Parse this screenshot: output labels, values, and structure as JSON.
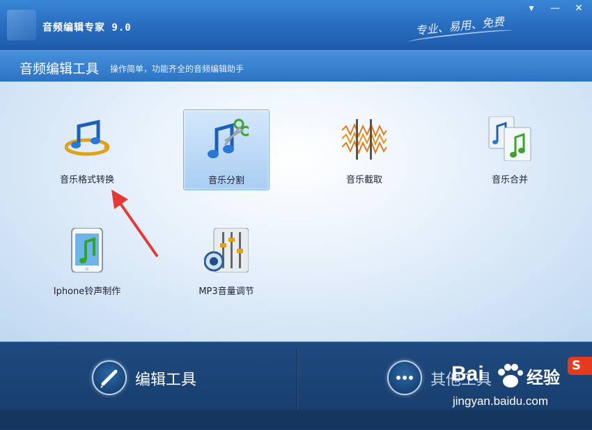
{
  "window": {
    "title": "音频编辑专家 9.0",
    "slogan": "专业、易用、免费",
    "controls": {
      "menu": "▾",
      "minimize": "—",
      "close": "✕"
    }
  },
  "header": {
    "title": "音频编辑工具",
    "subtitle": "操作简单，功能齐全的音频编辑助手"
  },
  "tools": [
    {
      "label": "音乐格式转换",
      "icon": "music-convert-icon"
    },
    {
      "label": "音乐分割",
      "icon": "music-scissors-icon",
      "selected": true
    },
    {
      "label": "音乐截取",
      "icon": "waveform-cut-icon"
    },
    {
      "label": "音乐合并",
      "icon": "music-files-merge-icon"
    },
    {
      "label": "Iphone铃声制作",
      "icon": "iphone-music-icon"
    },
    {
      "label": "MP3音量调节",
      "icon": "volume-mixer-icon"
    }
  ],
  "bottom": {
    "edit_tools": "编辑工具",
    "other_tools": "其他工具"
  },
  "watermark": {
    "brand": "Bai",
    "brand_suffix": "经验",
    "url": "jingyan.baidu.com",
    "badge": "S"
  },
  "colors": {
    "titlebar": "#2a6fc2",
    "bottom_bar": "#1f4a7f",
    "selected_tile": "#a9cdf2",
    "annotation_arrow": "#e53935"
  }
}
